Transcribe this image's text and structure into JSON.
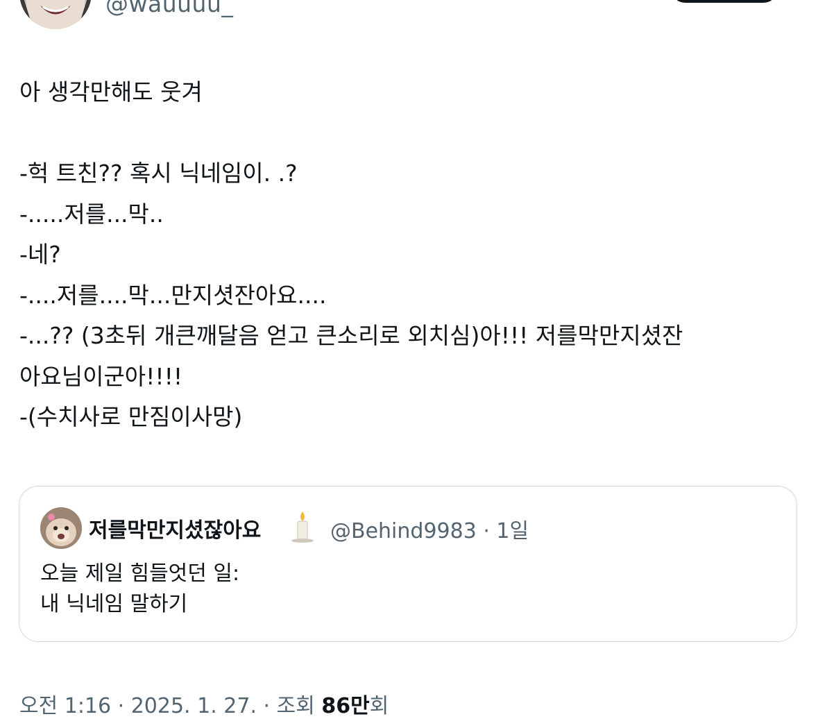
{
  "author": {
    "handle": "@wauuuu_"
  },
  "tweet": {
    "lines": [
      "아 생각만해도 웃겨",
      "",
      "-헉 트친?? 혹시 닉네임이. .?",
      "-.....저를...막..",
      "-네?",
      "-....저를....막...만지셧잔아요....",
      "-...?? (3초뒤 개큰깨달음 얻고 큰소리로 외치심)아!!! 저를막만지셨잔",
      "아요님이군아!!!!",
      "-(수치사로 만짐이사망)"
    ]
  },
  "quote": {
    "name": "저를막만지셨잖아요",
    "emoji_icon": "candle-icon",
    "meta": "@Behind9983 · 1일",
    "lines": [
      "오늘 제일 힘들엇던 일:",
      "내 닉네임 말하기"
    ]
  },
  "footer": {
    "time": "오전 1:16 · 2025. 1. 27. · 조회 ",
    "views": "86만",
    "views_suffix": "회"
  },
  "colors": {
    "text": "#0f1419",
    "secondary": "#536471",
    "border": "#cfd9de"
  }
}
